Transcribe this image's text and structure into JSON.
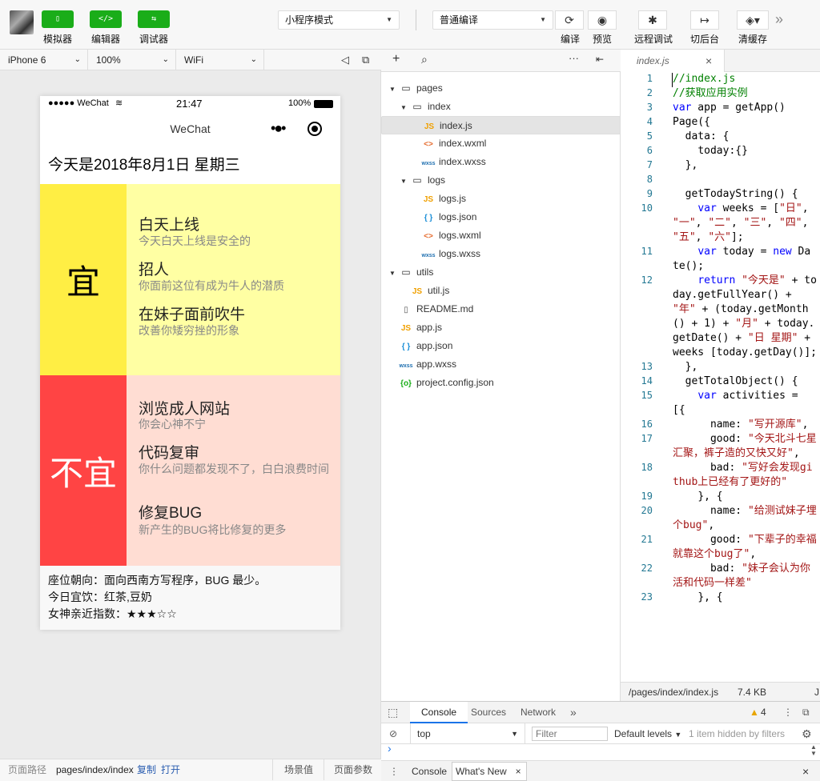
{
  "toolbar": {
    "simulator_label": "模拟器",
    "editor_label": "编辑器",
    "debugger_label": "调试器",
    "mode_select": "小程序模式",
    "compile_select": "普通编译",
    "compile_label": "编译",
    "preview_label": "预览",
    "remote_debug_label": "远程调试",
    "background_label": "切后台",
    "clear_cache_label": "清缓存",
    "more": "»",
    "accent_color": "#1aad19"
  },
  "device_bar": {
    "device": "iPhone 6",
    "zoom": "100%",
    "network": "WiFi"
  },
  "phone": {
    "status": {
      "carrier": "●●●●● WeChat",
      "time": "21:47",
      "battery": "100%"
    },
    "nav_title": "WeChat",
    "date_text": "今天是2018年8月1日 星期三",
    "good": {
      "tag": "宜",
      "color": "#ffee44",
      "bg": "#ffffa3",
      "items": [
        {
          "name": "白天上线",
          "desc": "今天白天上线是安全的"
        },
        {
          "name": "招人",
          "desc": "你面前这位有成为牛人的潜质"
        },
        {
          "name": "在妹子面前吹牛",
          "desc": "改善你矮穷挫的形象"
        }
      ]
    },
    "bad": {
      "tag": "不宜",
      "color": "#ff4444",
      "bg": "#ffddd3",
      "items": [
        {
          "name": "浏览成人网站",
          "desc": "你会心神不宁"
        },
        {
          "name": "代码复审",
          "desc": "你什么问题都发现不了，白白浪费时间"
        },
        {
          "name": "修复BUG",
          "desc": "新产生的BUG将比修复的更多"
        }
      ]
    },
    "footer": {
      "seat": "座位朝向：面向西南方写程序，BUG 最少。",
      "drink": "今日宜饮：红茶,豆奶",
      "goddess": "女神亲近指数：★★★☆☆"
    }
  },
  "bottom_bar": {
    "path_label": "页面路径",
    "path": "pages/index/index",
    "copy": "复制",
    "open": "打开",
    "scene": "场景值",
    "params": "页面参数"
  },
  "tree": {
    "rows": [
      {
        "label": "pages",
        "type": "folder",
        "depth": 0
      },
      {
        "label": "index",
        "type": "folder",
        "depth": 1
      },
      {
        "label": "index.js",
        "type": "js",
        "depth": 2,
        "selected": true
      },
      {
        "label": "index.wxml",
        "type": "wxml",
        "depth": 2
      },
      {
        "label": "index.wxss",
        "type": "wxss",
        "depth": 2
      },
      {
        "label": "logs",
        "type": "folder",
        "depth": 1
      },
      {
        "label": "logs.js",
        "type": "js",
        "depth": 2
      },
      {
        "label": "logs.json",
        "type": "json",
        "depth": 2
      },
      {
        "label": "logs.wxml",
        "type": "wxml",
        "depth": 2
      },
      {
        "label": "logs.wxss",
        "type": "wxss",
        "depth": 2
      },
      {
        "label": "utils",
        "type": "folder",
        "depth": 0
      },
      {
        "label": "util.js",
        "type": "js",
        "depth": 1
      },
      {
        "label": "README.md",
        "type": "doc",
        "depth": 0
      },
      {
        "label": "app.js",
        "type": "js",
        "depth": 0
      },
      {
        "label": "app.json",
        "type": "json",
        "depth": 0
      },
      {
        "label": "app.wxss",
        "type": "wxss",
        "depth": 0
      },
      {
        "label": "project.config.json",
        "type": "cfg",
        "depth": 0
      }
    ]
  },
  "editor": {
    "tab": "index.js",
    "status_path": "/pages/index/index.js",
    "status_size": "7.4 KB",
    "status_lang": "J",
    "lines": [
      {
        "n": "1",
        "html": "<span class=\"cm\">//index.js</span>"
      },
      {
        "n": "2",
        "html": "<span class=\"cm\">//获取应用实例</span>"
      },
      {
        "n": "3",
        "html": "<span class=\"kw\">var</span> app = getApp()"
      },
      {
        "n": "4",
        "html": "Page({"
      },
      {
        "n": "5",
        "html": "  data: {"
      },
      {
        "n": "6",
        "html": "    today:{}"
      },
      {
        "n": "7",
        "html": "  },"
      },
      {
        "n": "8",
        "html": ""
      },
      {
        "n": "9",
        "html": "  getTodayString() {"
      },
      {
        "n": "10",
        "html": "    <span class=\"kw\">var</span> weeks = [<span class=\"str\">\"日\"</span>, <span class=\"str\">\"一\"</span>, <span class=\"str\">\"二\"</span>, <span class=\"str\">\"三\"</span>, <span class=\"str\">\"四\"</span>, <span class=\"str\">\"五\"</span>, <span class=\"str\">\"六\"</span>];"
      },
      {
        "n": "11",
        "html": "    <span class=\"kw\">var</span> today = <span class=\"kw\">new</span> Date();"
      },
      {
        "n": "12",
        "html": "    <span class=\"kw\">return</span> <span class=\"str\">\"今天是\"</span> + today.getFullYear() + <span class=\"str\">\"年\"</span> + (today.getMonth() + 1) + <span class=\"str\">\"月\"</span> + today.getDate() + <span class=\"str\">\"日 星期\"</span> + weeks [today.getDay()];"
      },
      {
        "n": "13",
        "html": "  },"
      },
      {
        "n": "14",
        "html": "  getTotalObject() {"
      },
      {
        "n": "15",
        "html": "    <span class=\"kw\">var</span> activities = [{"
      },
      {
        "n": "16",
        "html": "      name: <span class=\"str\">\"写开源库\"</span>,"
      },
      {
        "n": "17",
        "html": "      good: <span class=\"str\">\"今天北斗七星汇聚，裤子造的又快又好\"</span>,"
      },
      {
        "n": "18",
        "html": "      bad: <span class=\"str\">\"写好会发现github上已经有了更好的\"</span>"
      },
      {
        "n": "19",
        "html": "    }, {"
      },
      {
        "n": "20",
        "html": "      name: <span class=\"str\">\"给测试妹子埋个bug\"</span>,"
      },
      {
        "n": "21",
        "html": "      good: <span class=\"str\">\"下辈子的幸福就靠这个bug了\"</span>,"
      },
      {
        "n": "22",
        "html": "      bad: <span class=\"str\">\"妹子会认为你活和代码一样差\"</span>"
      },
      {
        "n": "23",
        "html": "    }, {"
      }
    ]
  },
  "console": {
    "tabs": [
      "Console",
      "Sources",
      "Network"
    ],
    "more": "»",
    "warnings": "4",
    "context": "top",
    "filter_placeholder": "Filter",
    "levels": "Default levels",
    "hidden": "1 item hidden by filters",
    "prompt": "›",
    "drawer_console": "Console",
    "drawer_whatsnew": "What's New"
  }
}
